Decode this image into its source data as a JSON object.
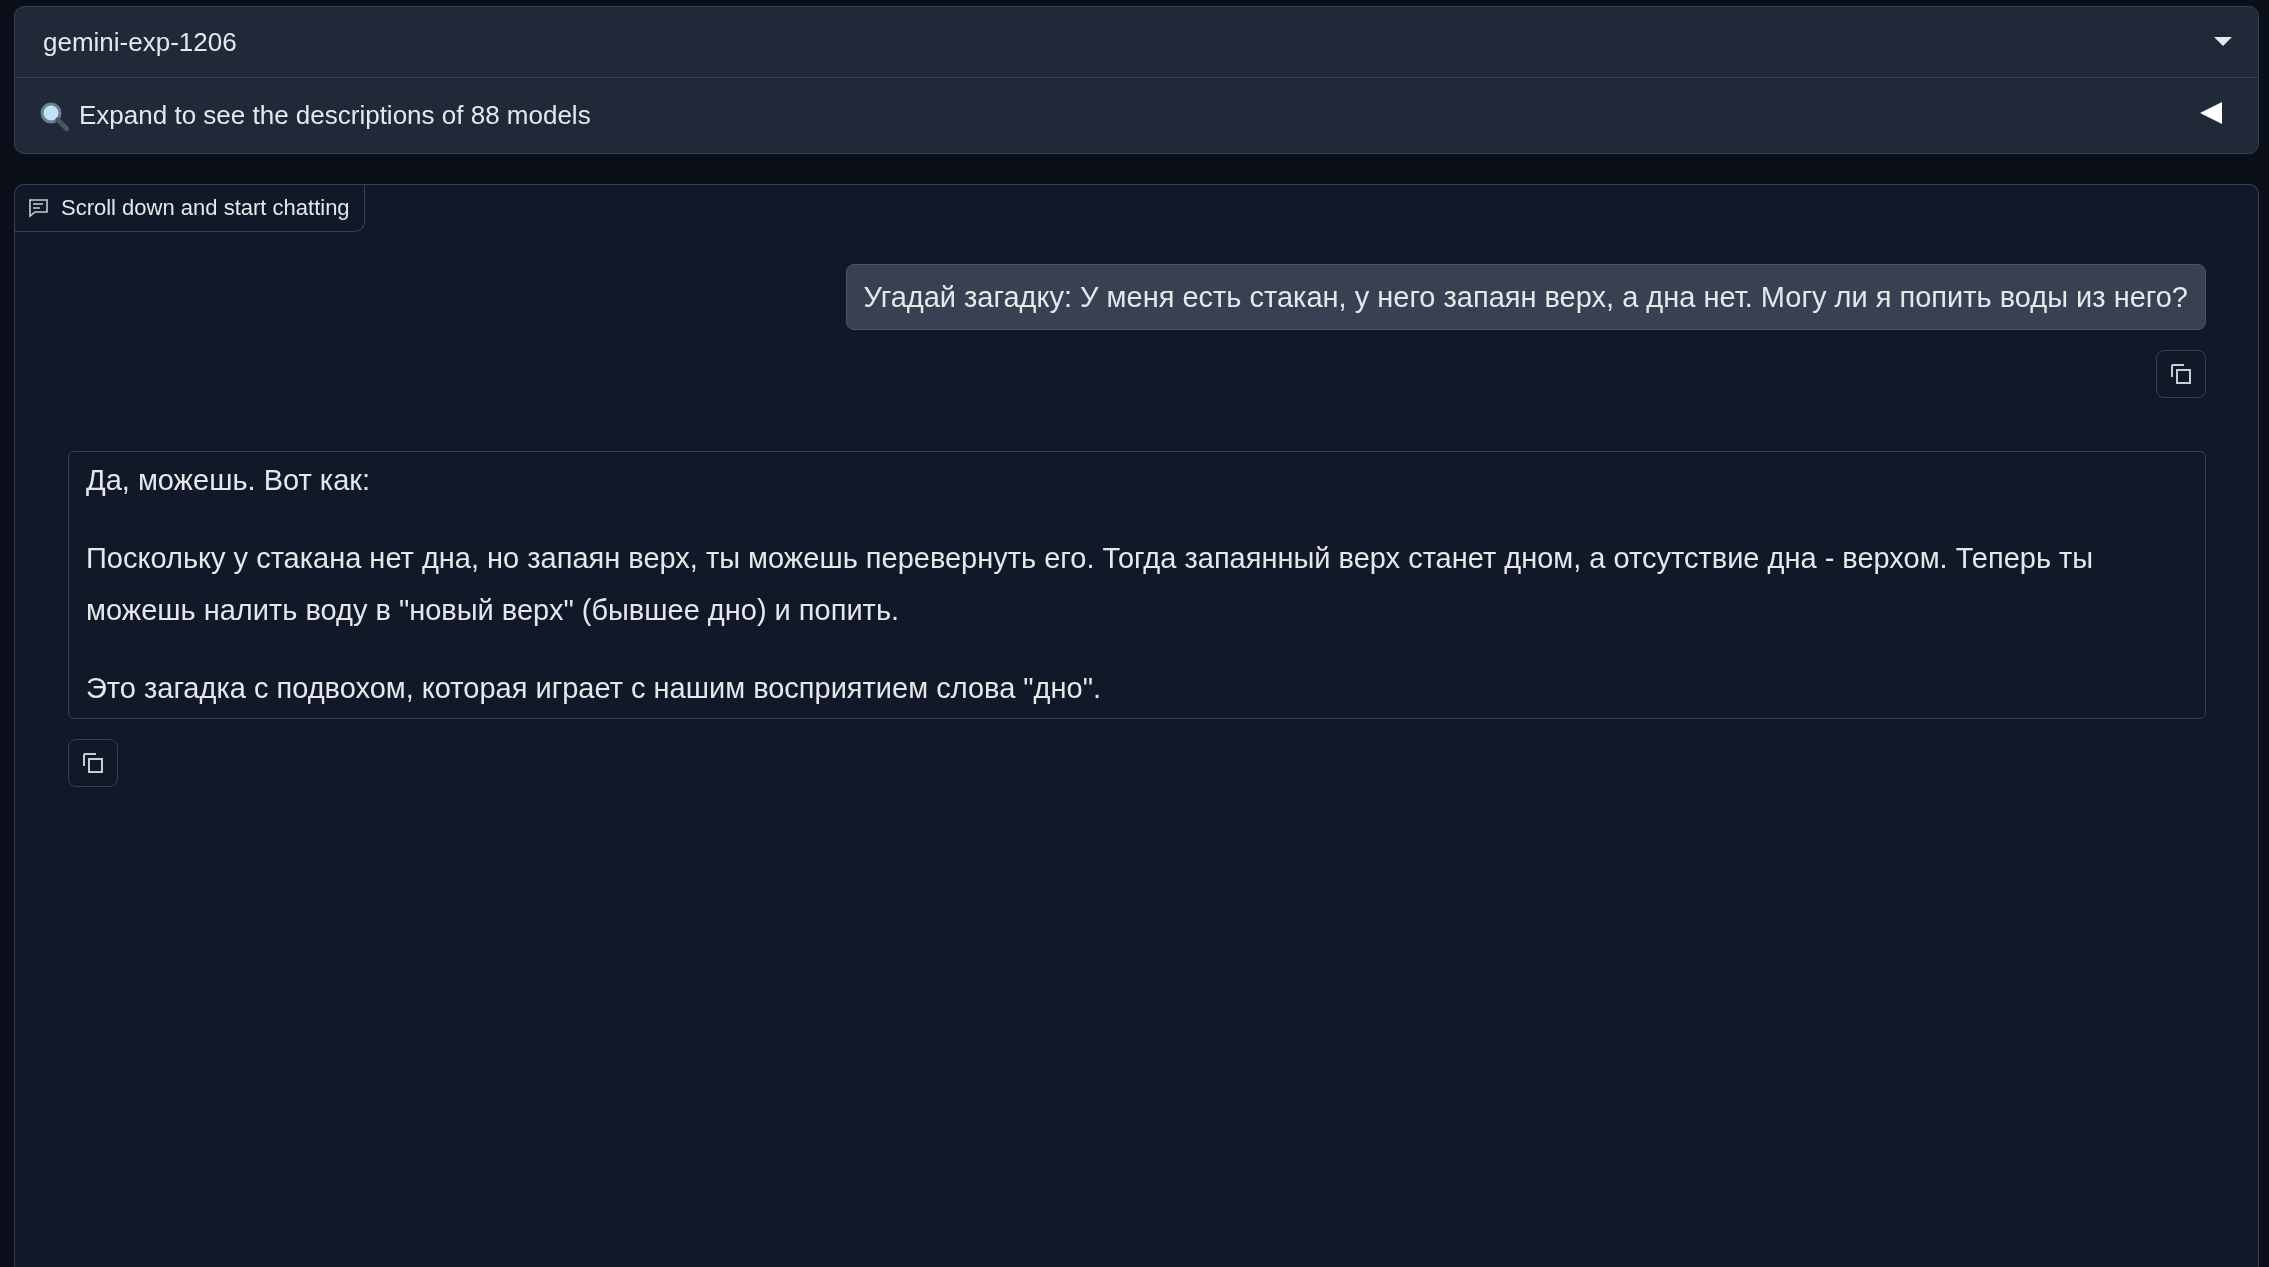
{
  "model_selector": {
    "value": "gemini-exp-1206"
  },
  "models_accordion": {
    "label": "Expand to see the descriptions of 88 models",
    "expanded": false
  },
  "chat": {
    "label": "Scroll down and start chatting",
    "messages": [
      {
        "kind": "user",
        "paragraphs": [
          "Угадай загадку: У меня есть стакан, у него запаян верх, а дна нет. Могу ли я попить воды из него?"
        ]
      },
      {
        "kind": "bot",
        "paragraphs": [
          "Да, можешь. Вот как:",
          "Поскольку у стакана нет дна, но запаян верх, ты можешь перевернуть его. Тогда запаянный верх станет дном, а отсутствие дна - верхом. Теперь ты можешь налить воду в \"новый верх\" (бывшее дно) и попить.",
          "Это загадка с подвохом, которая играет с нашим восприятием слова \"дно\"."
        ]
      }
    ]
  }
}
